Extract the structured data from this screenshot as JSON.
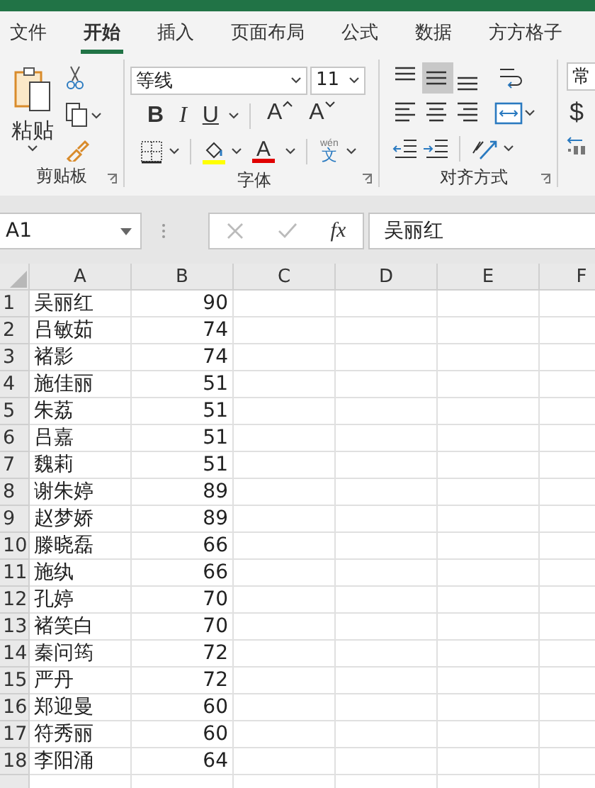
{
  "tabs": [
    {
      "label": "文件",
      "selected": false
    },
    {
      "label": "开始",
      "selected": true
    },
    {
      "label": "插入",
      "selected": false
    },
    {
      "label": "页面布局",
      "selected": false
    },
    {
      "label": "公式",
      "selected": false
    },
    {
      "label": "数据",
      "selected": false
    },
    {
      "label": "方方格子",
      "selected": false
    }
  ],
  "ribbon": {
    "clipboard": {
      "paste_label": "粘贴",
      "group_label": "剪贴板"
    },
    "font": {
      "font_name": "等线",
      "font_size": "11",
      "style_buttons": [
        {
          "label": "B",
          "kind": "bold"
        },
        {
          "label": "I",
          "kind": "italic"
        },
        {
          "label": "U",
          "kind": "underline"
        }
      ],
      "size_buttons": [
        {
          "label": "A",
          "kind": "grow"
        },
        {
          "label": "A",
          "kind": "shrink"
        }
      ],
      "font_color_label": "A",
      "phonetic": {
        "pinyin": "wén",
        "character": "文"
      },
      "group_label": "字体"
    },
    "alignment": {
      "vertical": [
        {
          "kind": "top",
          "selected": false
        },
        {
          "kind": "middle",
          "selected": true
        },
        {
          "kind": "bottom",
          "selected": false
        }
      ],
      "horizontal": [
        {
          "kind": "left",
          "selected": false
        },
        {
          "kind": "center",
          "selected": false
        },
        {
          "kind": "right",
          "selected": false
        }
      ],
      "group_label": "对齐方式"
    },
    "number": {
      "format": "常",
      "currency": "$"
    }
  },
  "formula_bar": {
    "name_box": "A1",
    "function_label": "fx",
    "value": "吴丽红"
  },
  "sheet": {
    "columns": [
      "A",
      "B",
      "C",
      "D",
      "E",
      "F"
    ],
    "rows": [
      {
        "number": "1",
        "a": "吴丽红",
        "b": "90"
      },
      {
        "number": "2",
        "a": "吕敏茹",
        "b": "74"
      },
      {
        "number": "3",
        "a": "褚影",
        "b": "74"
      },
      {
        "number": "4",
        "a": "施佳丽",
        "b": "51"
      },
      {
        "number": "5",
        "a": "朱荔",
        "b": "51"
      },
      {
        "number": "6",
        "a": "吕嘉",
        "b": "51"
      },
      {
        "number": "7",
        "a": "魏莉",
        "b": "51"
      },
      {
        "number": "8",
        "a": "谢朱婷",
        "b": "89"
      },
      {
        "number": "9",
        "a": "赵梦娇",
        "b": "89"
      },
      {
        "number": "10",
        "a": "滕晓磊",
        "b": "66"
      },
      {
        "number": "11",
        "a": "施纨",
        "b": "66"
      },
      {
        "number": "12",
        "a": "孔婷",
        "b": "70"
      },
      {
        "number": "13",
        "a": "褚笑白",
        "b": "70"
      },
      {
        "number": "14",
        "a": "秦问筠",
        "b": "72"
      },
      {
        "number": "15",
        "a": "严丹",
        "b": "72"
      },
      {
        "number": "16",
        "a": "郑迎曼",
        "b": "60"
      },
      {
        "number": "17",
        "a": "符秀丽",
        "b": "60"
      },
      {
        "number": "18",
        "a": "李阳涌",
        "b": "64"
      }
    ]
  }
}
